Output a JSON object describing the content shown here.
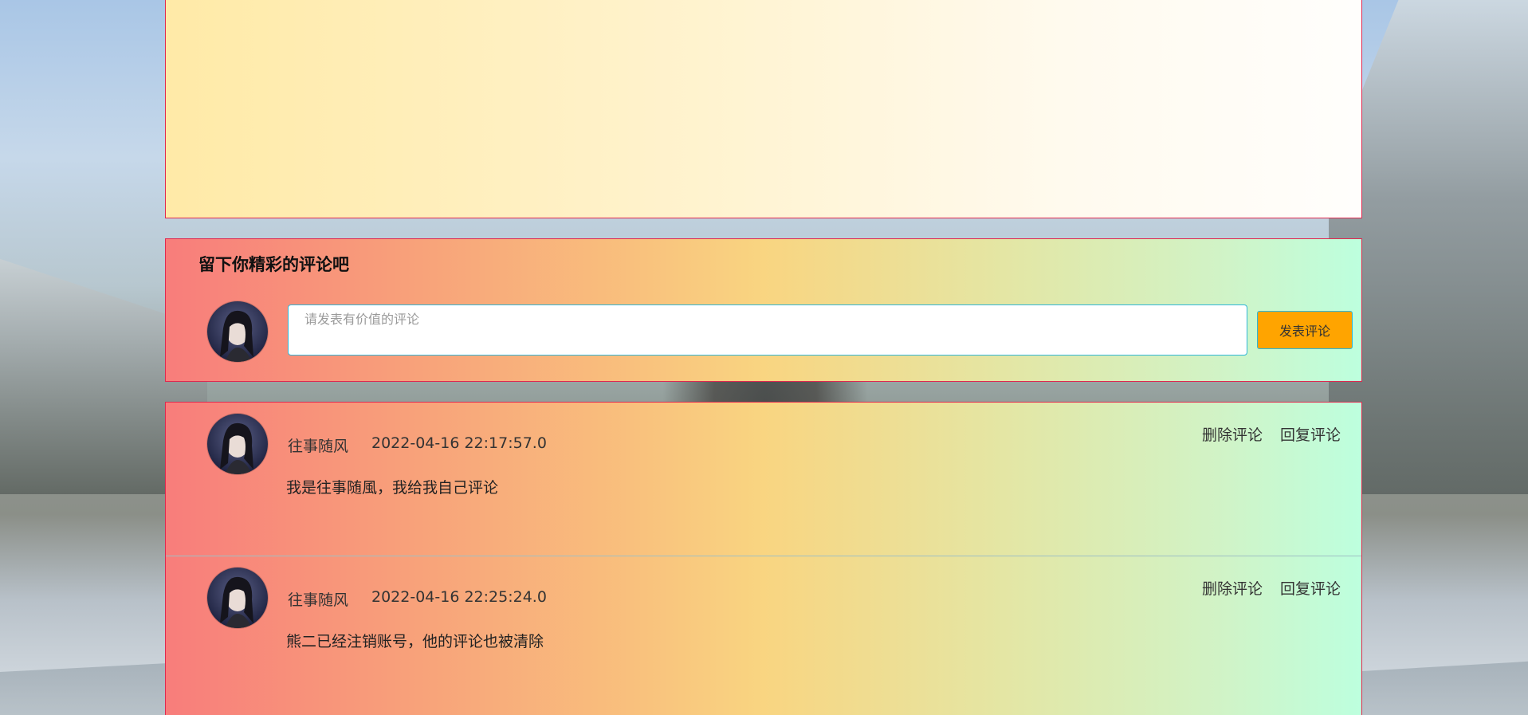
{
  "comment_form": {
    "title": "留下你精彩的评论吧",
    "placeholder": "请发表有价值的评论",
    "submit_label": "发表评论"
  },
  "comments": [
    {
      "user": "往事随风",
      "time": "2022-04-16 22:17:57.0",
      "text": "我是往事随風，我给我自己评论",
      "delete_label": "删除评论",
      "reply_label": "回复评论"
    },
    {
      "user": "往事随风",
      "time": "2022-04-16 22:25:24.0",
      "text": "熊二已经注销账号，他的评论也被清除",
      "delete_label": "删除评论",
      "reply_label": "回复评论"
    }
  ],
  "colors": {
    "panel_border": "#e0284f",
    "submit_bg": "#ffa400",
    "input_border": "#2fb6d8"
  },
  "icons": {
    "avatar": "user-avatar-image"
  }
}
